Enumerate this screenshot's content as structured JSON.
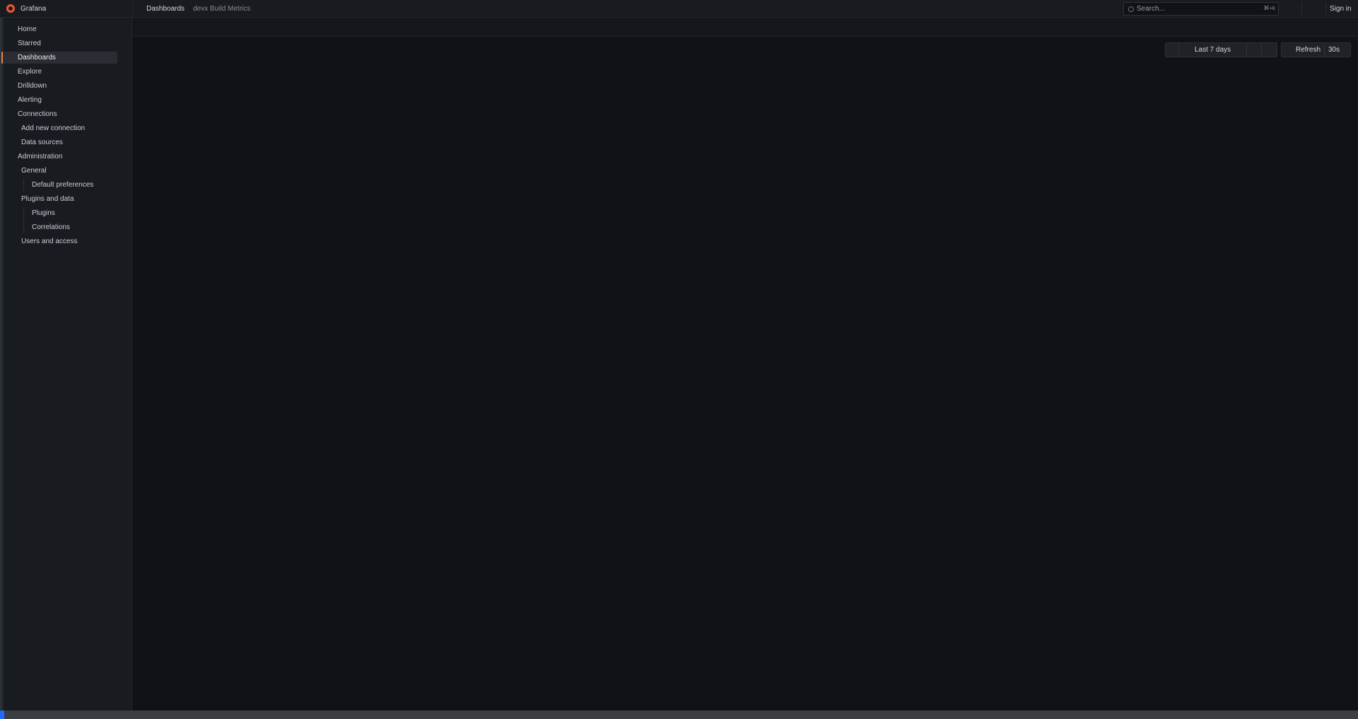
{
  "app": {
    "name": "Grafana",
    "logo_icon": "grafana-logo-icon",
    "accent": "#f08439"
  },
  "breadcrumb": {
    "section": "Dashboards",
    "page": "devx Build Metrics"
  },
  "search": {
    "placeholder": "Search...",
    "shortcut": "⌘+k"
  },
  "header": {
    "sign_in_label": "Sign in"
  },
  "sidebar": {
    "items": [
      {
        "label": "Home"
      },
      {
        "label": "Starred"
      },
      {
        "label": "Dashboards",
        "active": true
      },
      {
        "label": "Explore"
      },
      {
        "label": "Drilldown"
      },
      {
        "label": "Alerting"
      },
      {
        "label": "Connections"
      },
      {
        "label": "Add new connection"
      },
      {
        "label": "Data sources"
      },
      {
        "label": "Administration"
      },
      {
        "label": "General"
      },
      {
        "label": "Default preferences"
      },
      {
        "label": "Plugins and data"
      },
      {
        "label": "Plugins"
      },
      {
        "label": "Correlations"
      },
      {
        "label": "Users and access"
      }
    ]
  },
  "controls": {
    "time_range": "Last 7 days",
    "refresh_label": "Refresh",
    "refresh_interval": "30s"
  }
}
